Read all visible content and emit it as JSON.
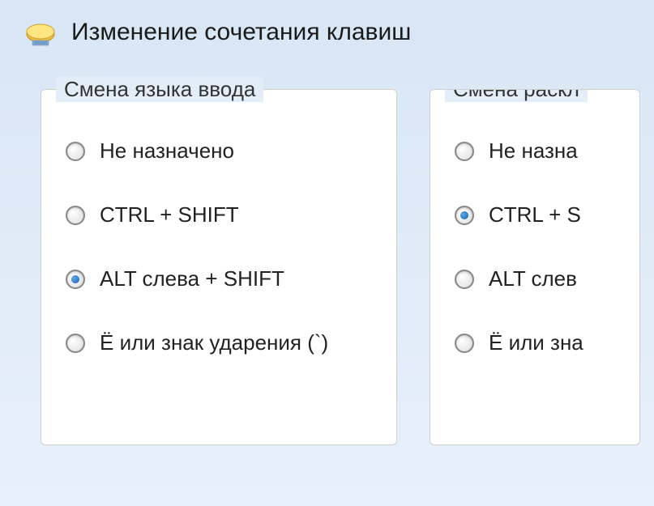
{
  "window": {
    "title": "Изменение сочетания клавиш"
  },
  "groups": {
    "left": {
      "legend": "Смена языка ввода",
      "options": [
        {
          "label": "Не назначено",
          "checked": false
        },
        {
          "label": "CTRL + SHIFT",
          "checked": false
        },
        {
          "label": "ALT слева + SHIFT",
          "checked": true
        },
        {
          "label": "Ё или знак ударения (`)",
          "checked": false
        }
      ]
    },
    "right": {
      "legend": "Смена раскл",
      "options": [
        {
          "label": "Не назна",
          "checked": false
        },
        {
          "label": "CTRL + S",
          "checked": true
        },
        {
          "label": "ALT слев",
          "checked": false
        },
        {
          "label": "Ё или зна",
          "checked": false
        }
      ]
    }
  }
}
